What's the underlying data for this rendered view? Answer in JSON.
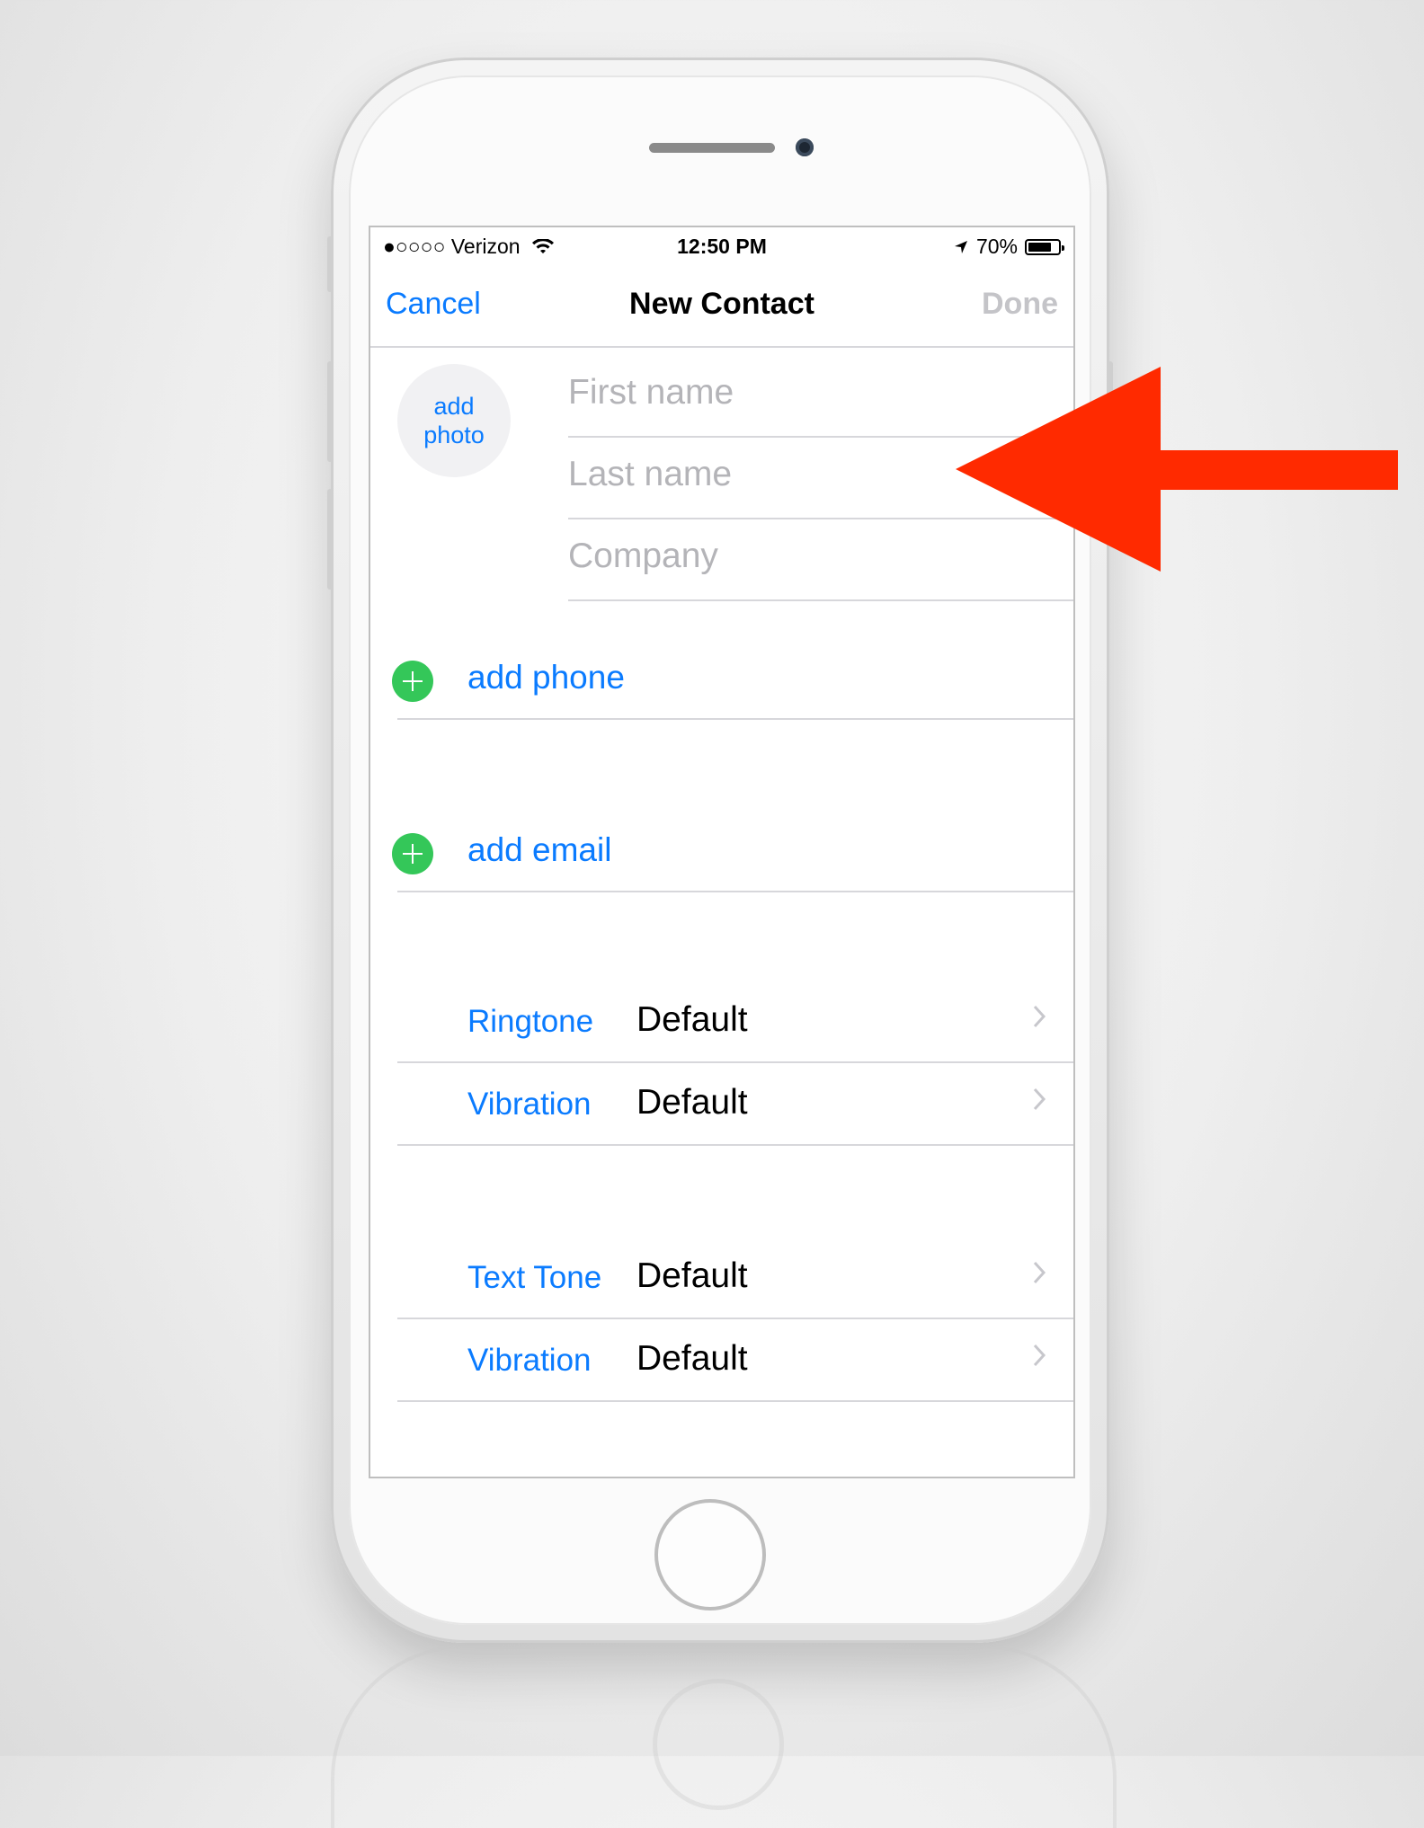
{
  "status_bar": {
    "carrier": "●○○○○ Verizon",
    "time": "12:50 PM",
    "battery": "70%",
    "battery_level": 0.7
  },
  "nav": {
    "cancel": "Cancel",
    "title": "New Contact",
    "done": "Done"
  },
  "photo": {
    "line1": "add",
    "line2": "photo"
  },
  "fields": {
    "first_name": "First name",
    "last_name": "Last name",
    "company": "Company"
  },
  "add_rows": {
    "phone": "add phone",
    "email": "add email"
  },
  "settings": [
    {
      "label": "Ringtone",
      "value": "Default"
    },
    {
      "label": "Vibration",
      "value": "Default"
    },
    {
      "label": "Text Tone",
      "value": "Default"
    },
    {
      "label": "Vibration",
      "value": "Default"
    }
  ],
  "colors": {
    "accent": "#0a7bff",
    "plus": "#34c759",
    "arrow": "#ff2a00"
  },
  "icons": [
    "wifi-icon",
    "location-arrow-icon",
    "battery-icon",
    "plus-circle-icon",
    "chevron-right-icon",
    "red-arrow-annotation"
  ]
}
